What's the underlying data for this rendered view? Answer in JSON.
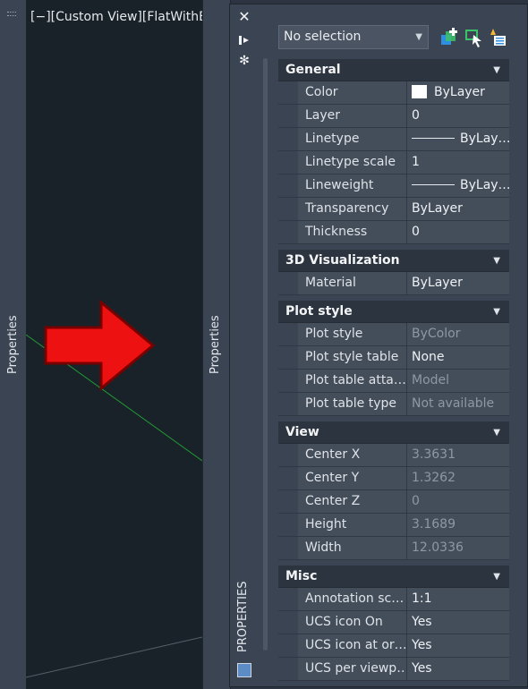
{
  "left_strip": {
    "label": "Properties"
  },
  "viewport": {
    "header": "[−][Custom View][FlatWithEd"
  },
  "mid_strip": {
    "label": "Properties"
  },
  "panel": {
    "vertical_title": "PROPERTIES",
    "toolbar": {
      "close_icon": "close-icon",
      "autohide_icon": "autohide-icon",
      "settings_icon": "settings-icon"
    },
    "selection": {
      "value": "No selection"
    },
    "quick_icons": [
      "toggle-pickadd-icon",
      "select-objects-icon",
      "quick-select-icon"
    ]
  },
  "sections": {
    "general": {
      "title": "General",
      "rows": [
        {
          "name": "Color",
          "value": "ByLayer"
        },
        {
          "name": "Layer",
          "value": "0"
        },
        {
          "name": "Linetype",
          "value": "ByLay…"
        },
        {
          "name": "Linetype scale",
          "value": "1"
        },
        {
          "name": "Lineweight",
          "value": "ByLay…"
        },
        {
          "name": "Transparency",
          "value": "ByLayer"
        },
        {
          "name": "Thickness",
          "value": "0"
        }
      ]
    },
    "visualization": {
      "title": "3D Visualization",
      "rows": [
        {
          "name": "Material",
          "value": "ByLayer"
        }
      ]
    },
    "plot_style": {
      "title": "Plot style",
      "rows": [
        {
          "name": "Plot style",
          "value": "ByColor"
        },
        {
          "name": "Plot style table",
          "value": "None"
        },
        {
          "name": "Plot table atta…",
          "value": "Model"
        },
        {
          "name": "Plot table type",
          "value": "Not available"
        }
      ]
    },
    "view": {
      "title": "View",
      "rows": [
        {
          "name": "Center X",
          "value": "3.3631"
        },
        {
          "name": "Center Y",
          "value": "1.3262"
        },
        {
          "name": "Center Z",
          "value": "0"
        },
        {
          "name": "Height",
          "value": "3.1689"
        },
        {
          "name": "Width",
          "value": "12.0336"
        }
      ]
    },
    "misc": {
      "title": "Misc",
      "rows": [
        {
          "name": "Annotation sc…",
          "value": "1:1"
        },
        {
          "name": "UCS icon On",
          "value": "Yes"
        },
        {
          "name": "UCS icon at or…",
          "value": "Yes"
        },
        {
          "name": "UCS per viewp…",
          "value": "Yes"
        }
      ]
    }
  },
  "colors": {
    "accent_arrow": "#ee1111",
    "arrow_border": "#7a0000",
    "icon_green": "#3cc36a",
    "icon_blue": "#2e8fe0"
  }
}
